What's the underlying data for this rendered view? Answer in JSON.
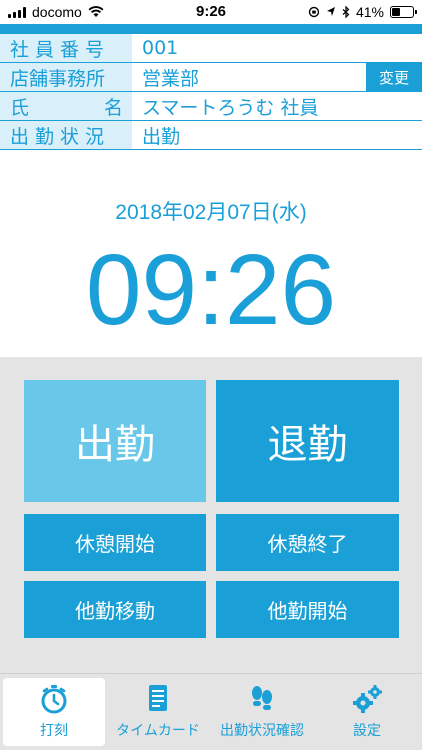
{
  "status_bar": {
    "carrier": "docomo",
    "time": "9:26",
    "battery": "41%",
    "battery_level": 0.41
  },
  "info": {
    "employee_no_label": "社員番号",
    "employee_no": "001",
    "office_label": "店舗事務所",
    "office": "営業部",
    "change_label": "変更",
    "name_label_1": "氏",
    "name_label_2": "名",
    "name": "スマートろうむ 社員",
    "status_label": "出勤状況",
    "status": "出勤"
  },
  "date": "2018年02月07日(水)",
  "clock": "09:26",
  "buttons": {
    "clock_in": "出勤",
    "clock_out": "退勤",
    "break_start": "休憩開始",
    "break_end": "休憩終了",
    "transfer_move": "他勤移動",
    "transfer_start": "他勤開始"
  },
  "tabs": [
    {
      "label": "打刻",
      "icon": "stopwatch-icon"
    },
    {
      "label": "タイムカード",
      "icon": "document-icon"
    },
    {
      "label": "出勤状況確認",
      "icon": "footprints-icon"
    },
    {
      "label": "設定",
      "icon": "gears-icon"
    }
  ],
  "colors": {
    "accent": "#1aa0d6",
    "accent_light": "#69c8ea",
    "label_bg": "#d9effa",
    "panel_bg": "#e4e4e4"
  }
}
